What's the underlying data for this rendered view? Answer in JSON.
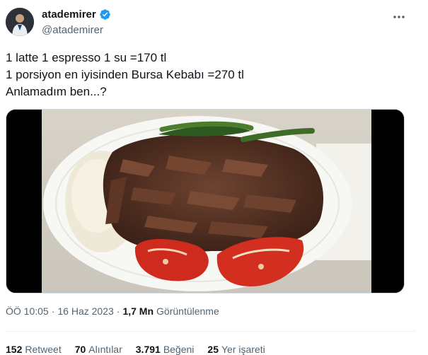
{
  "author": {
    "display_name": "atademirer",
    "handle": "@atademirer",
    "verified": true
  },
  "tweet": {
    "lines": [
      "1 latte 1 espresso 1 su =170 tl",
      "1 porsiyon en iyisinden Bursa Kebabı =270 tl",
      "Anlamadım ben...?"
    ]
  },
  "meta": {
    "time": "ÖÖ 10:05",
    "separator": "·",
    "date": "16 Haz 2023",
    "views_count": "1,7 Mn",
    "views_label": "Görüntülenme"
  },
  "stats": {
    "retweets": {
      "count": "152",
      "label": "Retweet"
    },
    "quotes": {
      "count": "70",
      "label": "Alıntılar"
    },
    "likes": {
      "count": "3.791",
      "label": "Beğeni"
    },
    "bookmarks": {
      "count": "25",
      "label": "Yer işareti"
    }
  },
  "colors": {
    "verified": "#1d9bf0",
    "secondary_text": "#536471",
    "primary_text": "#0f1419"
  },
  "icons": {
    "verified": "verified-badge-icon",
    "more": "more-options-icon"
  }
}
